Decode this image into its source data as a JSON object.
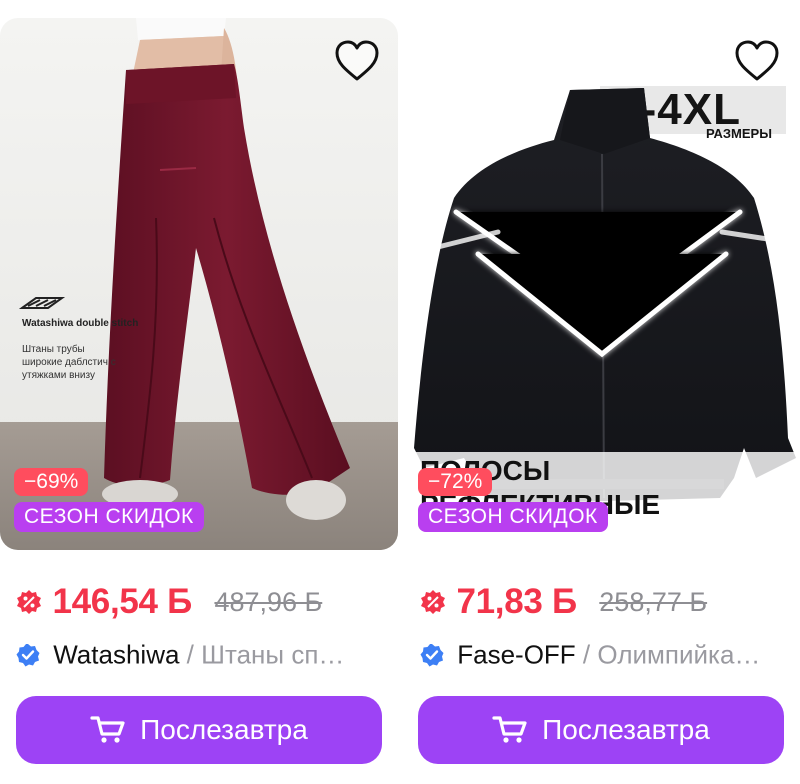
{
  "products": [
    {
      "image_text": {
        "title": "Watashiwa double stitch",
        "line1": "Штаны трубы",
        "line2": "широкие даблстич с",
        "line3": "утяжками внизу"
      },
      "discount_badge": "−69%",
      "promo_badge": "СЕЗОН СКИДОК",
      "price": "146,54 Б",
      "old_price": "487,96 Б",
      "brand": "Watashiwa",
      "separator": "/",
      "product_name": "Штаны сп…",
      "button_label": "Послезавтра",
      "favorite_icon": "heart-outline-icon"
    },
    {
      "image_text": {
        "size_range": "M-4XL",
        "size_caption": "РАЗМЕРЫ",
        "stripe_line1": "ПОЛОСЫ",
        "stripe_line2": "РЕФЛЕКТИВНЫЕ"
      },
      "discount_badge": "−72%",
      "promo_badge": "СЕЗОН СКИДОК",
      "price": "71,83 Б",
      "old_price": "258,77 Б",
      "brand": "Fase-OFF",
      "separator": "/",
      "product_name": "Олимпийка…",
      "button_label": "Послезавтра",
      "favorite_icon": "heart-outline-icon"
    }
  ],
  "colors": {
    "price": "#f2344a",
    "discount_badge": "#ff4d5e",
    "promo_badge": "#b93ff0",
    "button": "#9d43f5",
    "verified": "#3d7ff5"
  }
}
